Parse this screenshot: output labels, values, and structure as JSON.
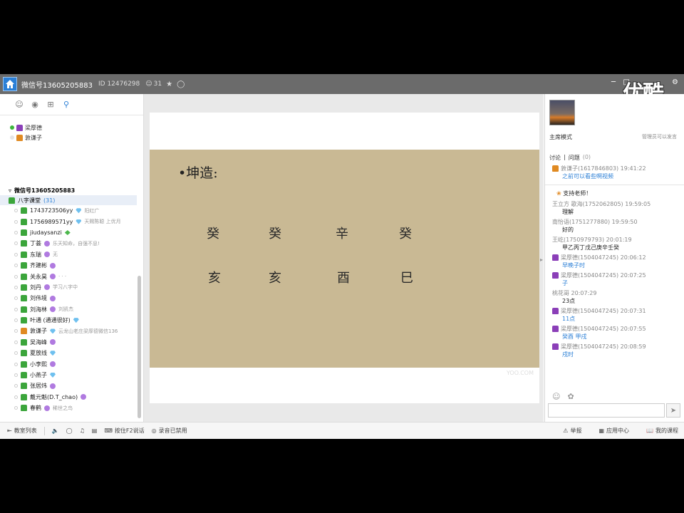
{
  "window": {
    "title": "微信号13605205883",
    "id_text": "ID 12476298",
    "user_count": "31",
    "logo": "优酷"
  },
  "left": {
    "teachers": [
      {
        "name": "梁厚德",
        "online": true,
        "color": "purple"
      },
      {
        "name": "敦谦子",
        "online": false,
        "color": "orange"
      }
    ],
    "group_title": "微信号13605205883",
    "subgroup": {
      "name": "八字课堂",
      "count": "(31)"
    },
    "members": [
      {
        "name": "1743723506yy",
        "badge": "d",
        "sign": "阳红广"
      },
      {
        "name": "1756989571yy",
        "badge": "d",
        "sign": "天赐陈聪 上优月"
      },
      {
        "name": "jiudaysanzi",
        "badge": "g",
        "sign": ""
      },
      {
        "name": "丁荟",
        "badge": "c",
        "sign": "乐天知命，自强不息!"
      },
      {
        "name": "东瑞",
        "badge": "c",
        "sign": "无"
      },
      {
        "name": "齐建彬",
        "badge": "c",
        "sign": ""
      },
      {
        "name": "关永昊",
        "badge": "c",
        "sign": "· · ·"
      },
      {
        "name": "刘丹",
        "badge": "c",
        "sign": "学习八字中"
      },
      {
        "name": "刘伟境",
        "badge": "c",
        "sign": ""
      },
      {
        "name": "刘海林",
        "badge": "c",
        "sign": "刘凯杰"
      },
      {
        "name": "叶通 (通通很好)",
        "badge": "d",
        "sign": ""
      },
      {
        "name": "敦谦子",
        "badge": "d",
        "sign": "云龙山老庄梁厚德微信136"
      },
      {
        "name": "吴海峰",
        "badge": "c",
        "sign": ""
      },
      {
        "name": "夏放线",
        "badge": "d",
        "sign": ""
      },
      {
        "name": "小李熙",
        "badge": "c",
        "sign": ""
      },
      {
        "name": "小燕子",
        "badge": "d",
        "sign": ""
      },
      {
        "name": "张居炜",
        "badge": "c",
        "sign": ""
      },
      {
        "name": "戴元魁(D.T_chao)",
        "badge": "c",
        "sign": ""
      },
      {
        "name": "春鹤",
        "badge": "c",
        "sign": "稀世之鸟"
      }
    ]
  },
  "slide": {
    "title": "•坤造:",
    "row1": [
      "癸",
      "癸",
      "辛",
      "癸"
    ],
    "row2": [
      "亥",
      "亥",
      "酉",
      "巳"
    ],
    "watermark": "YOO.COM"
  },
  "right": {
    "mode": "主席模式",
    "mode_note": "管理员可以发言",
    "tab_discuss": "讨论",
    "tab_question": "问题",
    "question_count": "(0)",
    "messages": [
      {
        "head": "敦谦子(1617846803) 19:41:22",
        "body": "之前可以看些啊视频",
        "link": true,
        "icon": "orange"
      },
      {
        "head": "",
        "body": "支持老师！",
        "link": false,
        "icon": "flower"
      },
      {
        "head": "王立方 歌海(1752062805) 19:59:05",
        "body": "理解",
        "link": false,
        "icon": ""
      },
      {
        "head": "南怡语(1751277880) 19:59:50",
        "body": "好的",
        "link": false,
        "icon": ""
      },
      {
        "head": "王屹(1750979793) 20:01:19",
        "body": "甲乙丙丁戊己庚辛壬癸",
        "link": false,
        "icon": ""
      },
      {
        "head": "梁厚德(1504047245) 20:06:12",
        "body": "早晚子时",
        "link": true,
        "icon": "purple"
      },
      {
        "head": "梁厚德(1504047245) 20:07:25",
        "body": "子",
        "link": true,
        "icon": "purple"
      },
      {
        "head": "桃花哥 20:07:29",
        "body": "23点",
        "link": false,
        "icon": ""
      },
      {
        "head": "梁厚德(1504047245) 20:07:31",
        "body": "11点",
        "link": true,
        "icon": "purple"
      },
      {
        "head": "梁厚德(1504047245) 20:07:55",
        "body": "癸酉  甲戌",
        "link": true,
        "icon": "purple"
      },
      {
        "head": "梁厚德(1504047245) 20:08:59",
        "body": "戌时",
        "link": true,
        "icon": "purple"
      }
    ]
  },
  "bottom": {
    "class_list": "教室列表",
    "f2_label": "按住F2说话",
    "record_label": "录音已禁用",
    "report": "举报",
    "app_center": "应用中心",
    "my_course": "我的课程"
  }
}
